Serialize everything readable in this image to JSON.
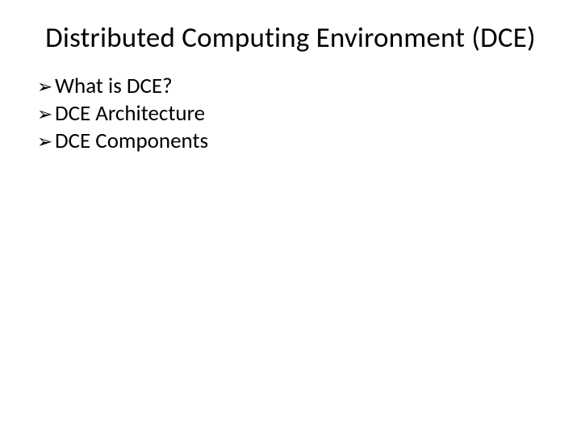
{
  "title": "Distributed Computing Environment (DCE)",
  "bullets": {
    "0": {
      "glyph": "➢",
      "text": "What is DCE?"
    },
    "1": {
      "glyph": "➢",
      "text": "DCE Architecture"
    },
    "2": {
      "glyph": "➢",
      "text": "DCE Components"
    }
  }
}
